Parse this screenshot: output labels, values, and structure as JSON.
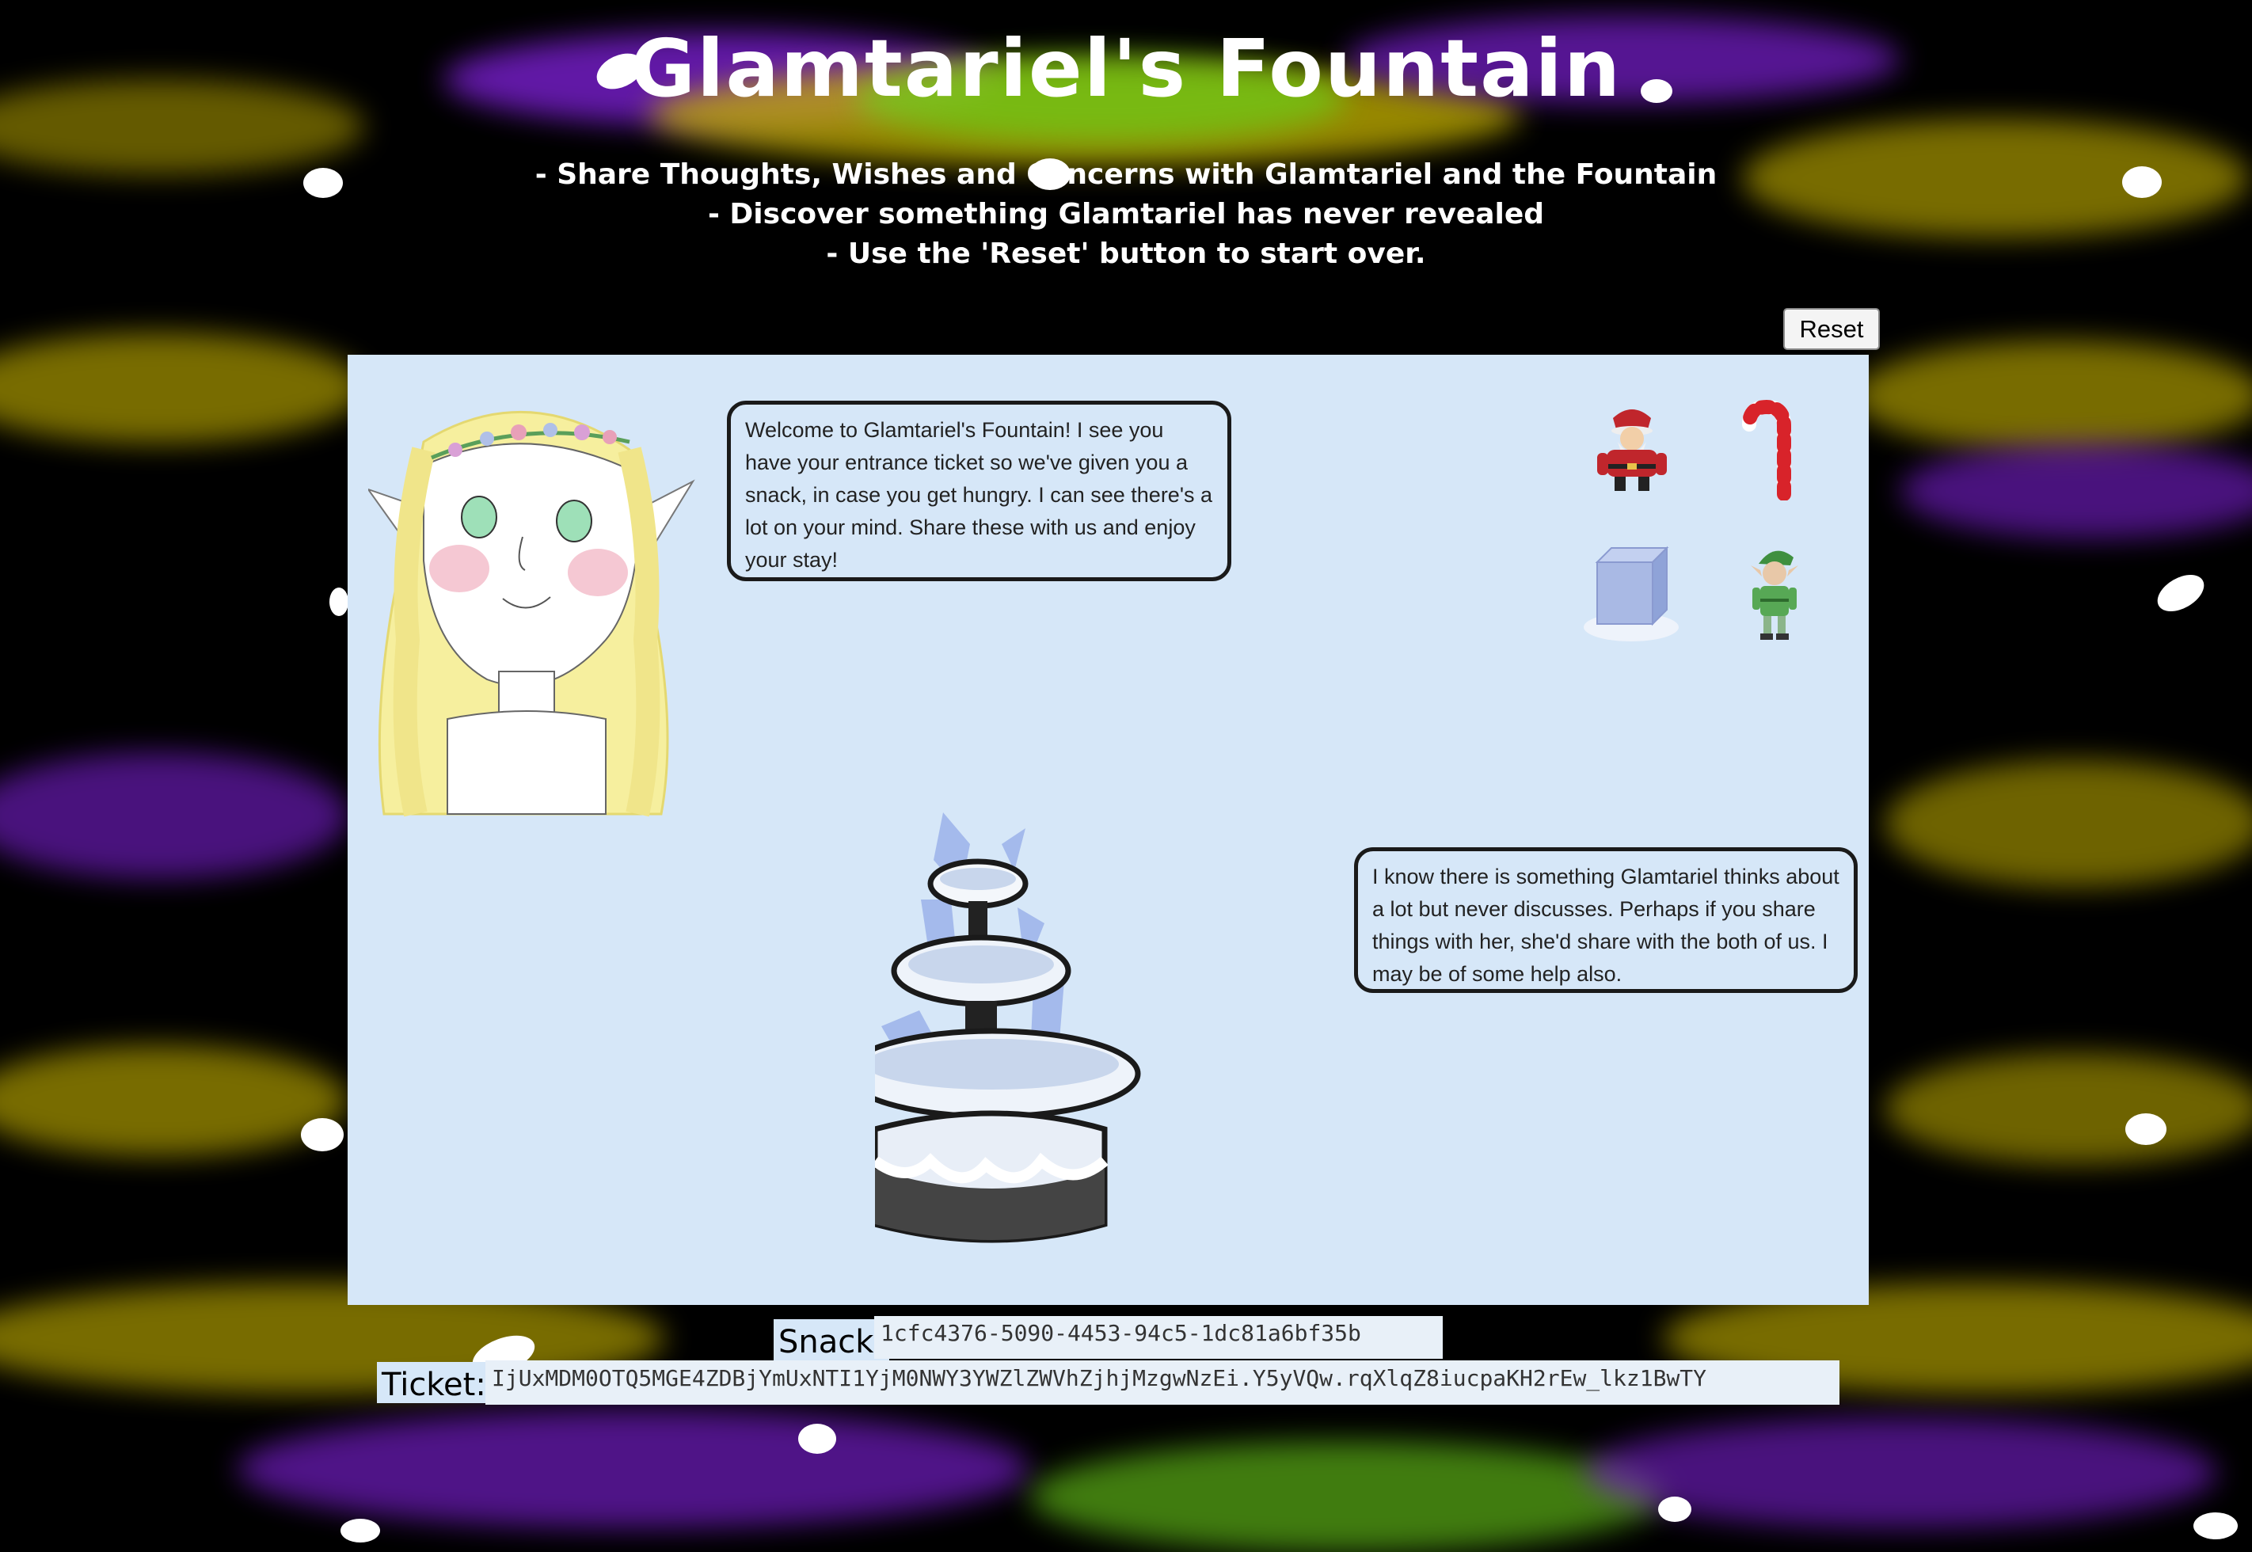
{
  "page": {
    "title": "Glamtariel's Fountain",
    "instructions": [
      "- Share Thoughts, Wishes and Concerns with Glamtariel and the Fountain",
      "- Discover something Glamtariel has never revealed",
      "- Use the 'Reset' button to start over."
    ]
  },
  "controls": {
    "reset_label": "Reset"
  },
  "dialogue": {
    "glamtariel": "Welcome to Glamtariel's Fountain! I see you have your entrance ticket so we've given you a snack, in case you get hungry. I can see there's a lot on your mind. Share these with us and enjoy your stay!",
    "fountain": "I know there is something Glamtariel thinks about a lot but never discusses. Perhaps if you share things with her, she'd share with the both of us. I may be of some help also."
  },
  "items": [
    "santa-icon",
    "candy-cane-icon",
    "ice-cube-icon",
    "elf-icon"
  ],
  "fields": {
    "snack_label": "Snack:",
    "snack_value": "1cfc4376-5090-4453-94c5-1dc81a6bf35b",
    "ticket_label": "Ticket:",
    "ticket_value": "IjUxMDM0OTQ5MGE4ZDBjYmUxNTI1YjM0NWY3YWZlZWVhZjhjMzgwNzEi.Y5yVQw.rqXlqZ8iucpaKH2rEw_lkz1BwTY"
  },
  "colors": {
    "stage_bg": "#d6e7f8",
    "streak_yellow": "#c8b400",
    "streak_purple": "#7a1fd0",
    "streak_green": "#6ccf1a"
  }
}
